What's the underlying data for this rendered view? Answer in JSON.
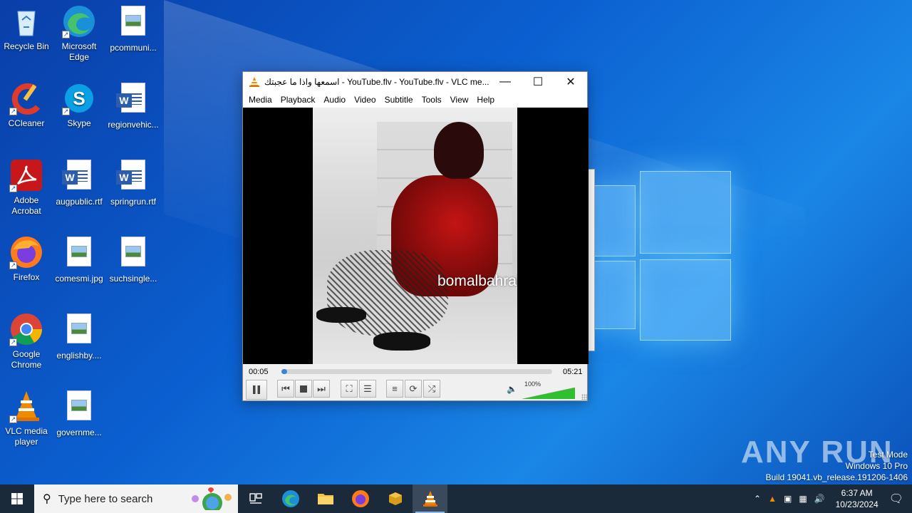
{
  "desktop": {
    "icons": [
      {
        "label": "Recycle Bin",
        "icon": "recycle-bin-icon"
      },
      {
        "label": "Microsoft Edge",
        "icon": "edge-icon"
      },
      {
        "label": "pcommuni...",
        "icon": "image-file-icon"
      },
      {
        "label": "CCleaner",
        "icon": "ccleaner-icon"
      },
      {
        "label": "Skype",
        "icon": "skype-icon"
      },
      {
        "label": "regionvehic...",
        "icon": "word-file-icon"
      },
      {
        "label": "Adobe Acrobat",
        "icon": "acrobat-icon"
      },
      {
        "label": "augpublic.rtf",
        "icon": "word-file-icon"
      },
      {
        "label": "springrun.rtf",
        "icon": "word-file-icon"
      },
      {
        "label": "Firefox",
        "icon": "firefox-icon"
      },
      {
        "label": "comesmi.jpg",
        "icon": "image-file-icon"
      },
      {
        "label": "suchsingle...",
        "icon": "image-file-icon"
      },
      {
        "label": "Google Chrome",
        "icon": "chrome-icon"
      },
      {
        "label": "englishby....",
        "icon": "image-file-icon"
      },
      {
        "label": "VLC media player",
        "icon": "vlc-icon"
      },
      {
        "label": "governme...",
        "icon": "image-file-icon"
      }
    ]
  },
  "vlc": {
    "title": "اسمعها واذا ما عجبتك - YouTube.flv - YouTube.flv - VLC me...",
    "menu": [
      "Media",
      "Playback",
      "Audio",
      "Video",
      "Subtitle",
      "Tools",
      "View",
      "Help"
    ],
    "video_watermark": "bomalbahrainia",
    "time_elapsed": "00:05",
    "time_total": "05:21",
    "progress_fraction": 0.016,
    "volume_label": "100%",
    "volume_fraction": 1.0,
    "colors": {
      "accent": "#3a83d8",
      "volume": "#2fbf2f"
    }
  },
  "watermark": {
    "brand": "ANY RUN",
    "line1": "Test Mode",
    "line2": "Windows 10 Pro",
    "line3": "Build 19041.vb_release.191206-1406"
  },
  "taskbar": {
    "search_placeholder": "Type here to search",
    "apps": [
      "task-view-icon",
      "edge-icon",
      "file-explorer-icon",
      "firefox-icon",
      "package-icon",
      "vlc-icon"
    ],
    "time": "6:37 AM",
    "date": "10/23/2024"
  }
}
